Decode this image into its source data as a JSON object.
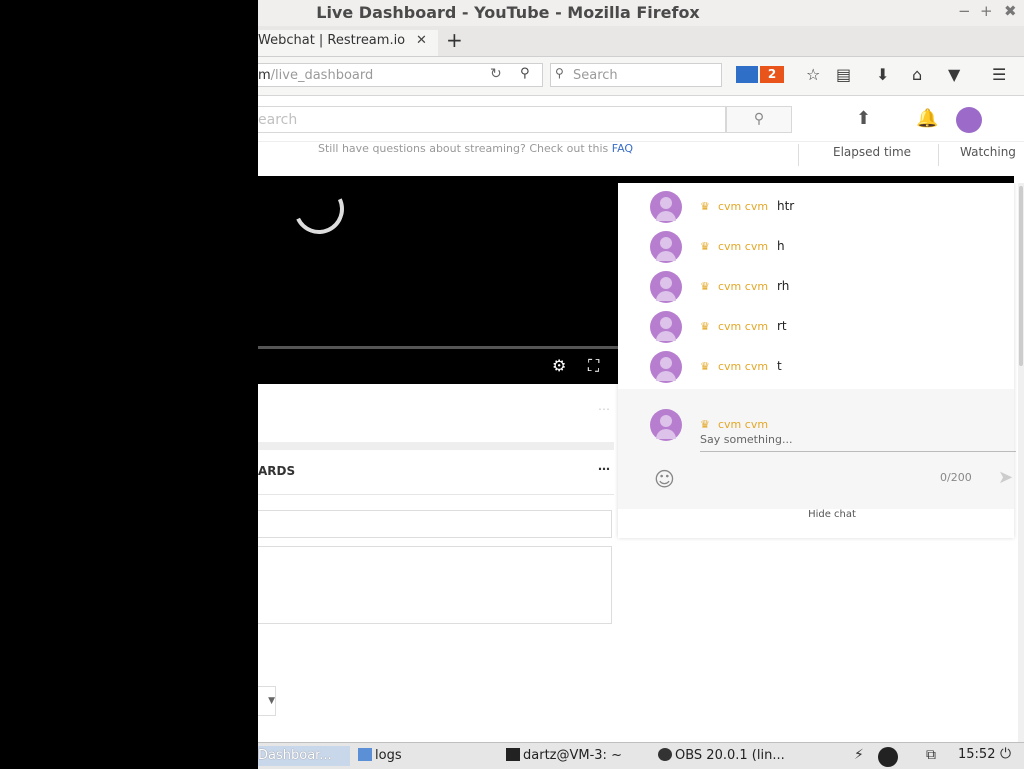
{
  "window": {
    "title": "Live Dashboard - YouTube - Mozilla Firefox",
    "minimize": "−",
    "maximize": "+",
    "close": "✖"
  },
  "tabs": [
    {
      "label": "Webchat | Restream.io",
      "close": "✕"
    }
  ],
  "new_tab": "+",
  "navbar": {
    "url_prefix": "m",
    "url_path": "/live_dashboard",
    "search_placeholder": "Search",
    "mail_badge": "2"
  },
  "youtube": {
    "search_placeholder": "earch",
    "faq_text": "Still have questions about streaming? Check out this",
    "faq_link": "FAQ",
    "elapsed_label": "Elapsed time",
    "watching_label": "Watching"
  },
  "chat": {
    "messages": [
      {
        "author": "cvm cvm",
        "text": "htr"
      },
      {
        "author": "cvm cvm",
        "text": "h"
      },
      {
        "author": "cvm cvm",
        "text": "rh"
      },
      {
        "author": "cvm cvm",
        "text": "rt"
      },
      {
        "author": "cvm cvm",
        "text": "t"
      }
    ],
    "composer_author": "cvm cvm",
    "placeholder": "Say something...",
    "counter": "0/200",
    "hide_label": "Hide chat"
  },
  "panels": {
    "cards_label": "ARDS"
  },
  "taskbar": {
    "tasks": [
      {
        "label": "Dashboar..."
      },
      {
        "label": "logs"
      },
      {
        "label": "dartz@VM-3: ~"
      },
      {
        "label": "OBS 20.0.1 (lin..."
      }
    ],
    "clock": "15:52"
  },
  "colors": {
    "accent_crown": "#e3a826",
    "avatar": "#b77ed0",
    "mail_badge": "#e8541a"
  }
}
